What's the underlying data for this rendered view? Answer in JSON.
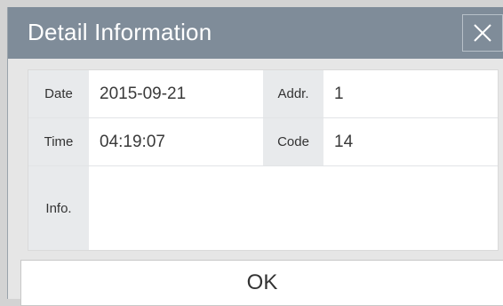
{
  "dialog": {
    "title": "Detail Information",
    "close_icon": "close-icon"
  },
  "fields": {
    "date_label": "Date",
    "date_value": "2015-09-21",
    "addr_label": "Addr.",
    "addr_value": "1",
    "time_label": "Time",
    "time_value": "04:19:07",
    "code_label": "Code",
    "code_value": "14",
    "info_label": "Info.",
    "info_value": ""
  },
  "buttons": {
    "ok_label": "OK"
  },
  "colors": {
    "titlebar": "#7f8c99",
    "label_bg": "#e8eaec"
  }
}
